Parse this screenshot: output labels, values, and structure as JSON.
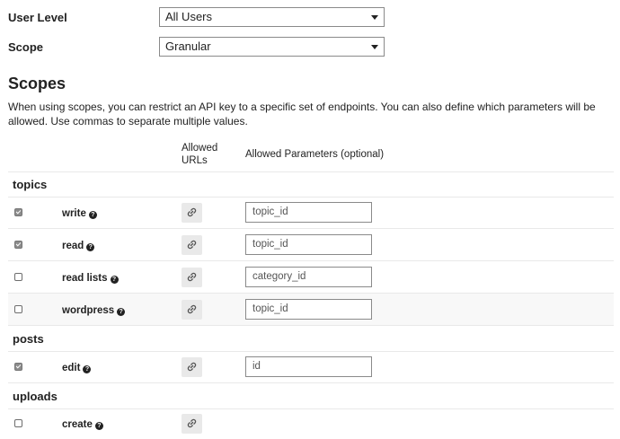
{
  "form": {
    "user_level": {
      "label": "User Level",
      "value": "All Users"
    },
    "scope": {
      "label": "Scope",
      "value": "Granular"
    }
  },
  "scopes": {
    "title": "Scopes",
    "description": "When using scopes, you can restrict an API key to a specific set of endpoints. You can also define which parameters will be allowed. Use commas to separate multiple values.",
    "columns": {
      "allowed_urls_line1": "Allowed",
      "allowed_urls_line2": "URLs",
      "allowed_params": "Allowed Parameters (optional)"
    },
    "groups": [
      {
        "name": "topics",
        "rows": [
          {
            "name": "write",
            "checked": true,
            "param": "topic_id"
          },
          {
            "name": "read",
            "checked": true,
            "param": "topic_id"
          },
          {
            "name": "read lists",
            "checked": false,
            "param": "category_id"
          },
          {
            "name": "wordpress",
            "checked": false,
            "param": "topic_id"
          }
        ]
      },
      {
        "name": "posts",
        "rows": [
          {
            "name": "edit",
            "checked": true,
            "param": "id"
          }
        ]
      },
      {
        "name": "uploads",
        "rows": [
          {
            "name": "create",
            "checked": false,
            "param": ""
          }
        ]
      }
    ]
  },
  "icons": {
    "help": "question-circle-icon",
    "link": "link-icon"
  },
  "help_glyph": "?"
}
